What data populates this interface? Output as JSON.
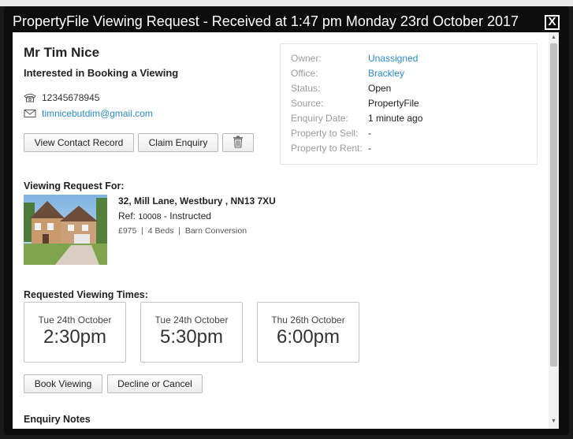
{
  "window": {
    "title": "PropertyFile Viewing Request - Received at 1:47 pm Monday 23rd October 2017",
    "close_label": "X"
  },
  "contact": {
    "name": "Mr Tim Nice",
    "interest": "Interested in Booking a Viewing",
    "phone": "12345678945",
    "email": "timnicebutdim@gmail.com"
  },
  "actions": {
    "view_contact": "View Contact Record",
    "claim_enquiry": "Claim Enquiry"
  },
  "info": {
    "rows": [
      {
        "label": "Owner:",
        "value": "Unassigned",
        "link": true
      },
      {
        "label": "Office:",
        "value": "Brackley",
        "link": true
      },
      {
        "label": "Status:",
        "value": "Open",
        "link": false
      },
      {
        "label": "Source:",
        "value": "PropertyFile",
        "link": false
      },
      {
        "label": "Enquiry Date:",
        "value": "1 minute ago",
        "link": false
      },
      {
        "label": "Property to Sell:",
        "value": "-",
        "link": false
      },
      {
        "label": "Property to Rent:",
        "value": "-",
        "link": false
      }
    ]
  },
  "viewing": {
    "heading": "Viewing Request For:",
    "address": "32, Mill Lane, Westbury , NN13 7XU",
    "ref_prefix": "Ref:",
    "ref_number": "10008",
    "ref_status": "- Instructed",
    "details": "£975  |  4 Beds  |  Barn Conversion"
  },
  "times": {
    "heading": "Requested Viewing Times:",
    "slots": [
      {
        "date": "Tue 24th October",
        "time": "2:30pm"
      },
      {
        "date": "Tue 24th October",
        "time": "5:30pm"
      },
      {
        "date": "Thu 26th October",
        "time": "6:00pm"
      }
    ]
  },
  "booking": {
    "book_label": "Book Viewing",
    "decline_label": "Decline or Cancel"
  },
  "notes": {
    "heading": "Enquiry Notes"
  },
  "icons": {
    "phone": "phone-icon",
    "email": "envelope-icon",
    "delete": "trash-icon"
  },
  "colors": {
    "link": "#2a8ac7",
    "modal_frame": "#0d0d0d"
  }
}
